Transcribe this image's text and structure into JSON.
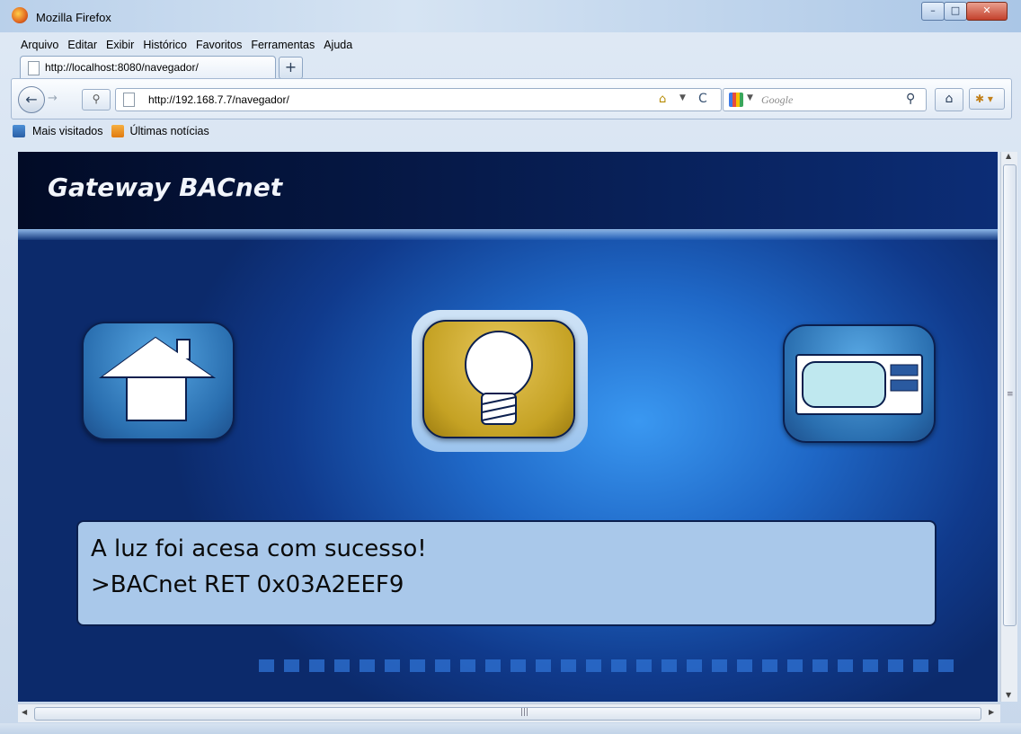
{
  "window": {
    "title": "Mozilla Firefox",
    "minimize": "–",
    "maximize": "□",
    "close": "✕"
  },
  "menu": [
    "Arquivo",
    "Editar",
    "Exibir",
    "Histórico",
    "Favoritos",
    "Ferramentas",
    "Ajuda"
  ],
  "tab": {
    "label": "http://localhost:8080/navegador/",
    "new_tab": "+"
  },
  "navbar": {
    "url": "http://192.168.7.7/navegador/",
    "search_placeholder": "Google",
    "back_glyph": "←",
    "forward_glyph": "→",
    "reload_glyph": "C"
  },
  "bookmarks": [
    "Mais visitados",
    "Últimas notícias"
  ],
  "page": {
    "title": "Gateway BACnet",
    "message_line1": "A luz foi acesa com sucesso!",
    "message_line2": ">BACnet RET 0x03A2EEF9",
    "buttons": [
      {
        "icon": "house-icon",
        "selected": false
      },
      {
        "icon": "lightbulb-icon",
        "selected": true
      },
      {
        "icon": "tv-icon",
        "selected": false
      }
    ]
  },
  "colors": {
    "header": "#061a4a",
    "background": "#1f68c7",
    "light_button": "#c5a224",
    "message_box": "#a9c8ea"
  }
}
